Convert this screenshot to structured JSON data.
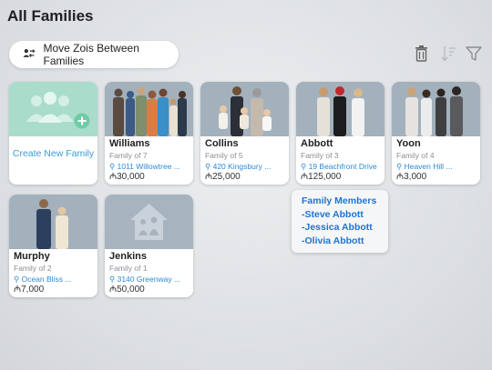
{
  "page_title": "All Families",
  "move_button": {
    "label": "Move Zois Between Families",
    "icon": "move-people-icon"
  },
  "toolbar": {
    "icons": [
      "trash-icon",
      "sort-icon",
      "filter-icon"
    ]
  },
  "create_card": {
    "label": "Create New Family",
    "icon": "add-family-icon",
    "color": "#a9dccb"
  },
  "families": [
    {
      "name": "Williams",
      "size": "Family of 7",
      "address": "1011 Willowtree ...",
      "funds": "30,000"
    },
    {
      "name": "Collins",
      "size": "Family of 5",
      "address": "420 Kingsbury ...",
      "funds": "25,000"
    },
    {
      "name": "Abbott",
      "size": "Family of 3",
      "address": "19 Beachfront Drive",
      "funds": "125,000"
    },
    {
      "name": "Yoon",
      "size": "Family of 4",
      "address": "Heaven Hill ...",
      "funds": "3,000"
    },
    {
      "name": "Murphy",
      "size": "Family of 2",
      "address": "Ocean Bliss ...",
      "funds": "7,000"
    },
    {
      "name": "Jenkins",
      "size": "Family of 1",
      "address": "3140 Greenway ...",
      "funds": "50,000"
    }
  ],
  "currency_symbol": "₼",
  "tooltip": {
    "title": "Family Members",
    "members": [
      "-Steve Abbott",
      "-Jessica Abbott",
      "-Olivia Abbott"
    ]
  },
  "colors": {
    "accent": "#2f8ad3",
    "tooltip_text": "#1e74d2"
  }
}
